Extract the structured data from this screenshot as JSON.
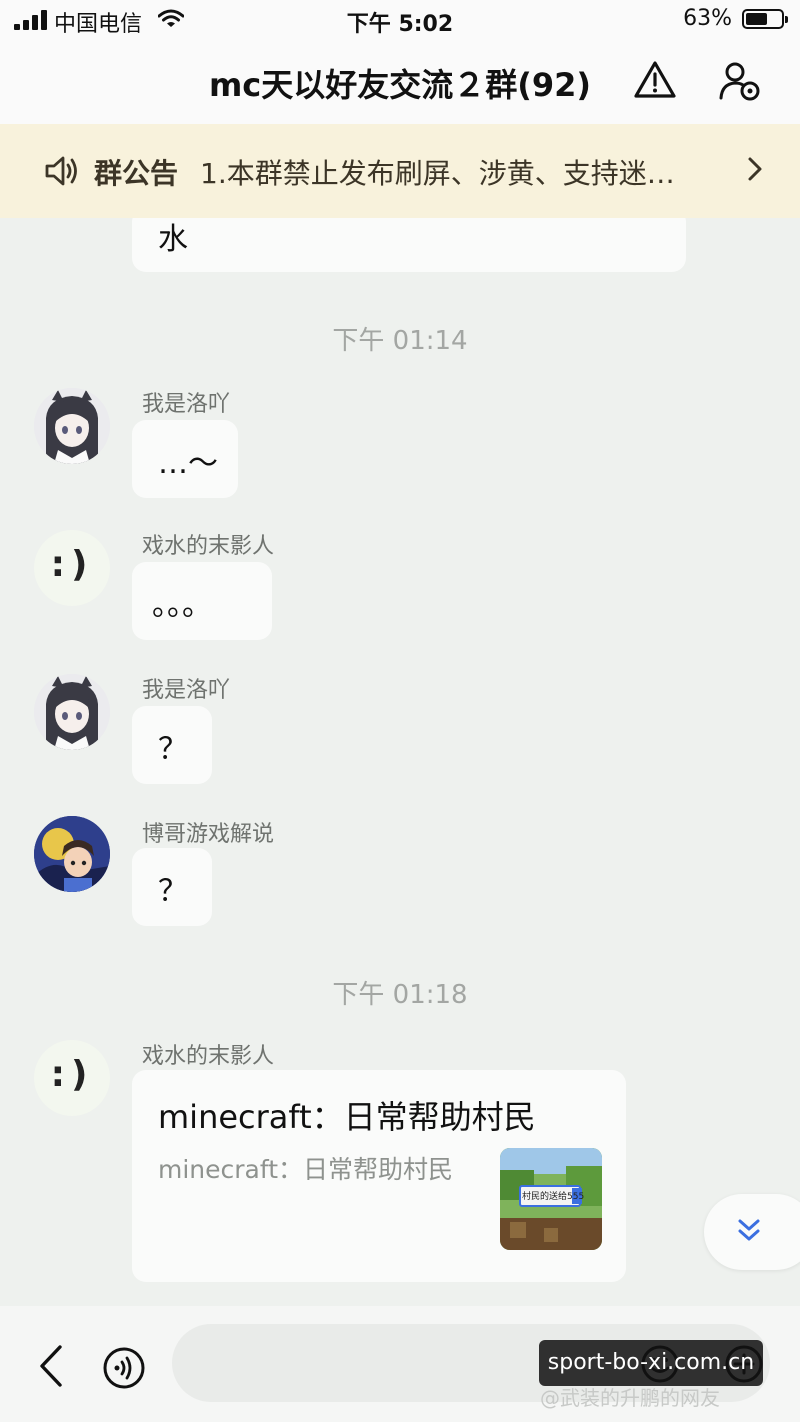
{
  "status_bar": {
    "carrier": "中国电信",
    "time": "下午 5:02",
    "battery_percent": "63%",
    "battery_level": 0.63
  },
  "header": {
    "title": "mc天以好友交流２群(92)",
    "warning_icon": "warning-triangle-icon",
    "settings_icon": "group-settings-icon"
  },
  "notice": {
    "label": "群公告",
    "text": "1.本群禁止发布刷屏、涉黄、支持迷…",
    "icon": "speaker-icon"
  },
  "messages": [
    {
      "type": "text",
      "text": "水"
    },
    {
      "type": "time",
      "text": "下午 01:14"
    },
    {
      "type": "text",
      "sender": "我是洛吖",
      "text": "…～",
      "avatar": "anime-girl-avatar"
    },
    {
      "type": "text",
      "sender": "戏水的末影人",
      "text": "。。。",
      "avatar": "smiley-avatar",
      "face": ":)"
    },
    {
      "type": "text",
      "sender": "我是洛吖",
      "text": "？",
      "avatar": "anime-girl-avatar"
    },
    {
      "type": "text",
      "sender": "博哥游戏解说",
      "text": "？",
      "avatar": "cartoon-avatar"
    },
    {
      "type": "time",
      "text": "下午 01:18"
    },
    {
      "type": "card",
      "sender": "戏水的末影人",
      "title": "minecraft：日常帮助村民",
      "subtitle": "minecraft：日常帮助村民",
      "avatar": "smiley-avatar",
      "face": ":)",
      "thumb_caption": "村民的送给555"
    }
  ],
  "colors": {
    "background": "#eef1ee",
    "notice_bg": "#f8f2dc",
    "bubble": "#fafbfa",
    "accent_blue": "#3b6fe0"
  },
  "watermark": {
    "site": "sport-bo-xi.com.cn",
    "credit": "@武装的升鹏的网友"
  }
}
